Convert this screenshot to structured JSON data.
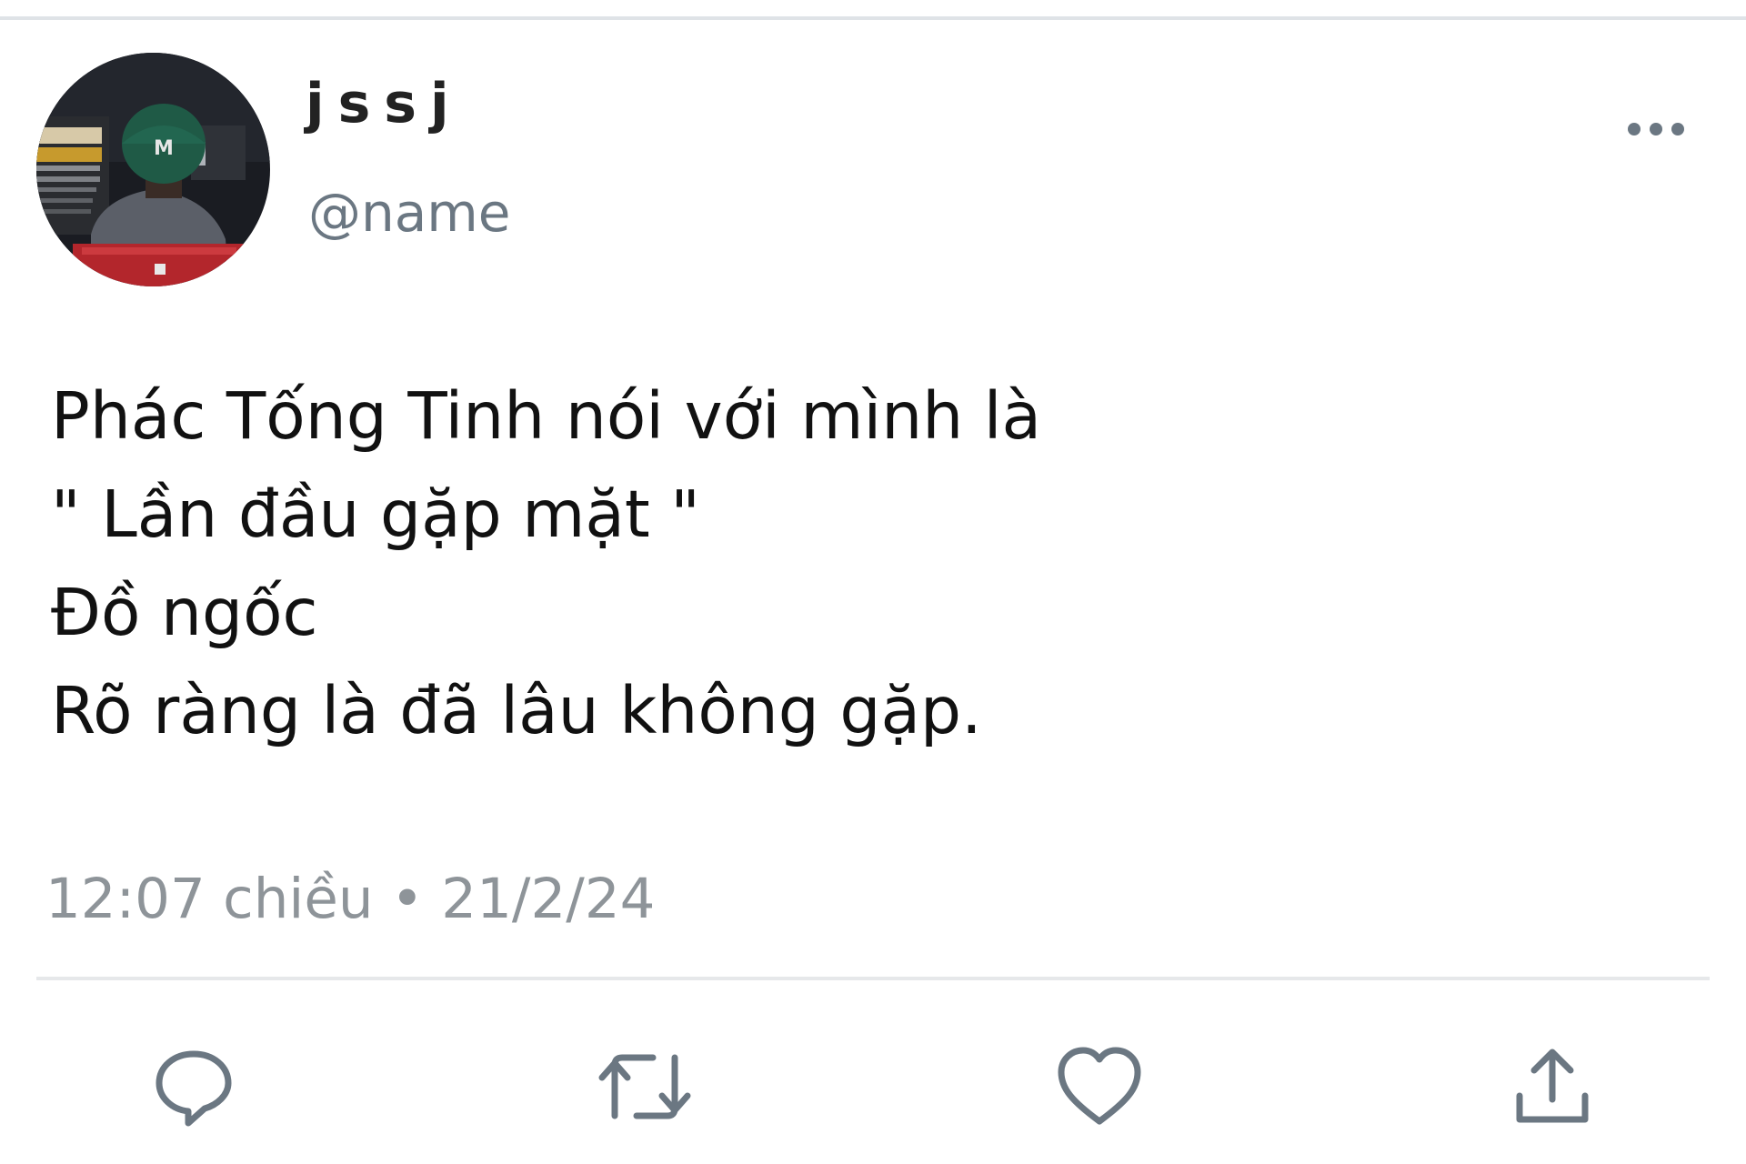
{
  "tweet": {
    "author": {
      "display_name": "jssj",
      "handle": "@name",
      "avatar_icon": "avatar-photo"
    },
    "more_icon": "more-dots-icon",
    "text_lines": [
      "Phác Tống Tinh nói với mình là",
      "\" Lần đầu gặp mặt \"",
      "Đồ ngốc",
      "Rõ ràng là đã lâu không gặp."
    ],
    "timestamp": "12:07 chiều • 21/2/24"
  },
  "actions": [
    {
      "name": "reply",
      "icon": "reply-icon"
    },
    {
      "name": "retweet",
      "icon": "retweet-icon"
    },
    {
      "name": "like",
      "icon": "heart-icon"
    },
    {
      "name": "share",
      "icon": "share-icon"
    }
  ],
  "colors": {
    "icon_gray": "#6b7782",
    "meta_gray": "#8e9499",
    "divider": "#e6e8ea"
  }
}
